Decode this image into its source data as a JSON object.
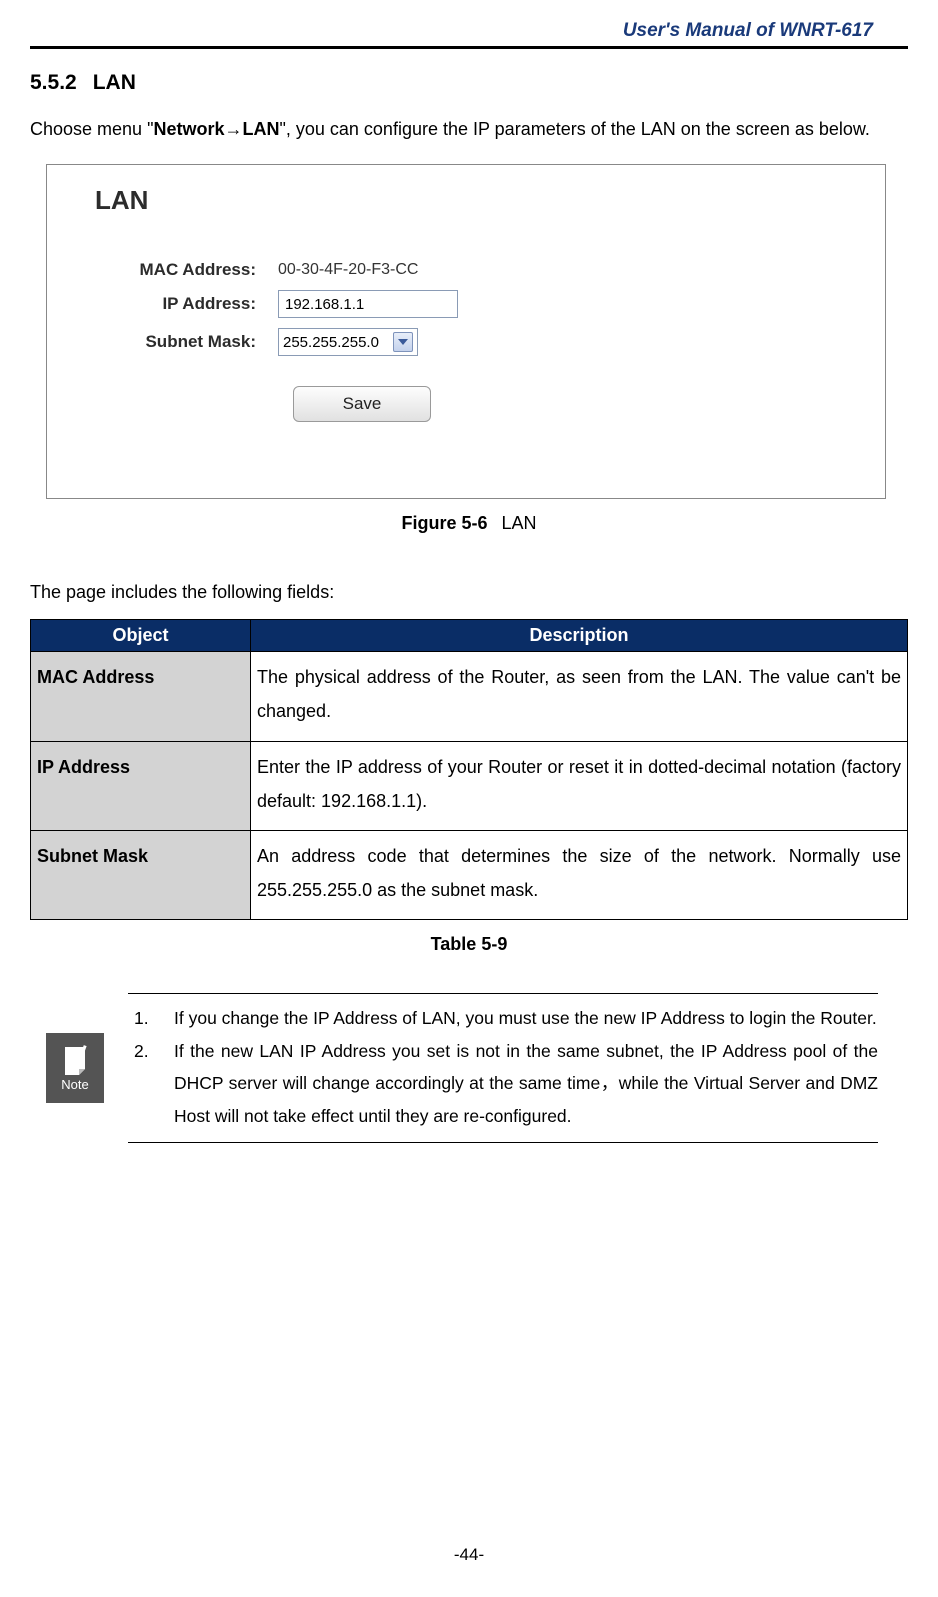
{
  "header": {
    "manual_title": "User's Manual of WNRT-617"
  },
  "section": {
    "number": "5.5.2",
    "title": "LAN"
  },
  "intro": {
    "prefix": "Choose menu \"",
    "path": "Network→LAN",
    "suffix": "\", you can configure the IP parameters of the LAN on the screen as below."
  },
  "screenshot": {
    "heading": "LAN",
    "mac_label": "MAC Address:",
    "mac_value": "00-30-4F-20-F3-CC",
    "ip_label": "IP Address:",
    "ip_value": "192.168.1.1",
    "subnet_label": "Subnet Mask:",
    "subnet_value": "255.255.255.0",
    "save_label": "Save"
  },
  "figure_caption": {
    "bold": "Figure 5-6",
    "text": "LAN"
  },
  "fields_intro": "The page includes the following fields:",
  "table": {
    "header_object": "Object",
    "header_description": "Description",
    "rows": [
      {
        "object": "MAC Address",
        "description": "The physical address of the Router, as seen from the LAN. The value can't be changed."
      },
      {
        "object": "IP Address",
        "description": "Enter the IP address of your Router or reset it in dotted-decimal notation (factory default: 192.168.1.1)."
      },
      {
        "object": "Subnet Mask",
        "description": "An address code that determines the size of the network. Normally use 255.255.255.0 as the subnet mask."
      }
    ]
  },
  "table_caption": "Table 5-9",
  "note": {
    "icon_label": "Note",
    "items": [
      "If you change the IP Address of LAN, you must use the new IP Address to login the Router.",
      "If the new LAN IP Address you set is not in the same subnet, the IP Address pool of the DHCP server will change accordingly at the same time，while the Virtual Server and DMZ Host will not take effect until they are re-configured."
    ]
  },
  "page_number": "-44-"
}
